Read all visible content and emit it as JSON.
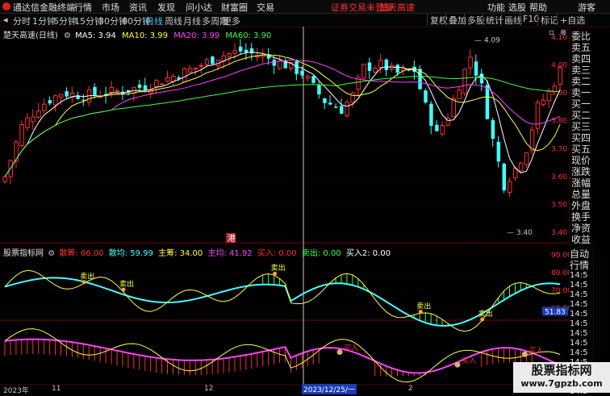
{
  "menu": {
    "app_title": "通达信金融终端",
    "items": [
      "行情",
      "市场",
      "资讯",
      "发现",
      "问小达",
      "财富圈",
      "交易"
    ],
    "notice": "证券交易未登录",
    "stock_tag": "楚天高速",
    "right_items": [
      "功能",
      "选股",
      "帮助",
      "游客"
    ]
  },
  "toolbar": {
    "periods": [
      "分时",
      "1分钟",
      "5分钟",
      "15分钟",
      "30分钟",
      "60分钟",
      "日线",
      "周线",
      "月线",
      "多周期",
      "更多"
    ],
    "active": "日线",
    "right_buttons": [
      "复权",
      "叠加",
      "多股",
      "统计",
      "画线",
      "F10",
      "标记",
      "+自选"
    ]
  },
  "kline": {
    "title": "楚天高速(日线)",
    "ma": [
      {
        "label": "MA5: 3.94",
        "color": "#ffffff"
      },
      {
        "label": "MA10: 3.99",
        "color": "#ffff40"
      },
      {
        "label": "MA20: 3.99",
        "color": "#ff40ff"
      },
      {
        "label": "MA60: 3.90",
        "color": "#40ff40"
      }
    ],
    "axis_ticks": [
      "4.10",
      "4.00",
      "3.90",
      "3.80",
      "3.70",
      "3.60",
      "3.50",
      "3.40"
    ],
    "high_label": "4.09",
    "low_label": "3.40",
    "marker": "港"
  },
  "indicator": {
    "name": "股票指标网",
    "values": [
      {
        "label": "散筹: 66.00",
        "color": "#ff3030"
      },
      {
        "label": "散均: 59.99",
        "color": "#40ffff"
      },
      {
        "label": "主筹: 34.00",
        "color": "#ffff40"
      },
      {
        "label": "主均: 41.92",
        "color": "#ff40ff"
      },
      {
        "label": "买入: 0.00",
        "color": "#ff3030"
      },
      {
        "label": "卖出: 0.00",
        "color": "#40ff40"
      },
      {
        "label": "买入2: 0.00",
        "color": "#ffffff"
      }
    ],
    "upper_ticks": [
      "90.00",
      "80.00",
      "70.00",
      "60.00"
    ],
    "lower_ticks": [
      "30.00"
    ],
    "cursor_value": "51.83",
    "sell_label": "卖出",
    "buy_label": "买入"
  },
  "date_axis": {
    "labels": [
      "2023年",
      "11",
      "12",
      "2023/12/25/一",
      "2"
    ]
  },
  "quote_panel": {
    "items": [
      "委比",
      "卖五",
      "卖四",
      "卖三",
      "卖二",
      "卖一",
      "买一",
      "买二",
      "买三",
      "买四",
      "买五",
      "现价",
      "涨跌",
      "涨幅",
      "总量",
      "外盘",
      "换手",
      "净资",
      "收益"
    ]
  },
  "tick_panel": {
    "title": "自动",
    "title2": "行情",
    "times": [
      "14:5",
      "14:5",
      "14:5",
      "14:5",
      "14:5",
      "14:5",
      "14:5",
      "14:5",
      "14:5",
      "14:5",
      "14:5",
      "14:5",
      "14:5"
    ]
  },
  "watermark": {
    "text": "股票指标网",
    "url": "www.7gpzb.com"
  },
  "colors": {
    "up": "#ff3030",
    "down": "#40ffff",
    "ma5": "#ffffff",
    "ma10": "#ffff40",
    "ma20": "#ff40ff",
    "ma60": "#40ff40"
  }
}
